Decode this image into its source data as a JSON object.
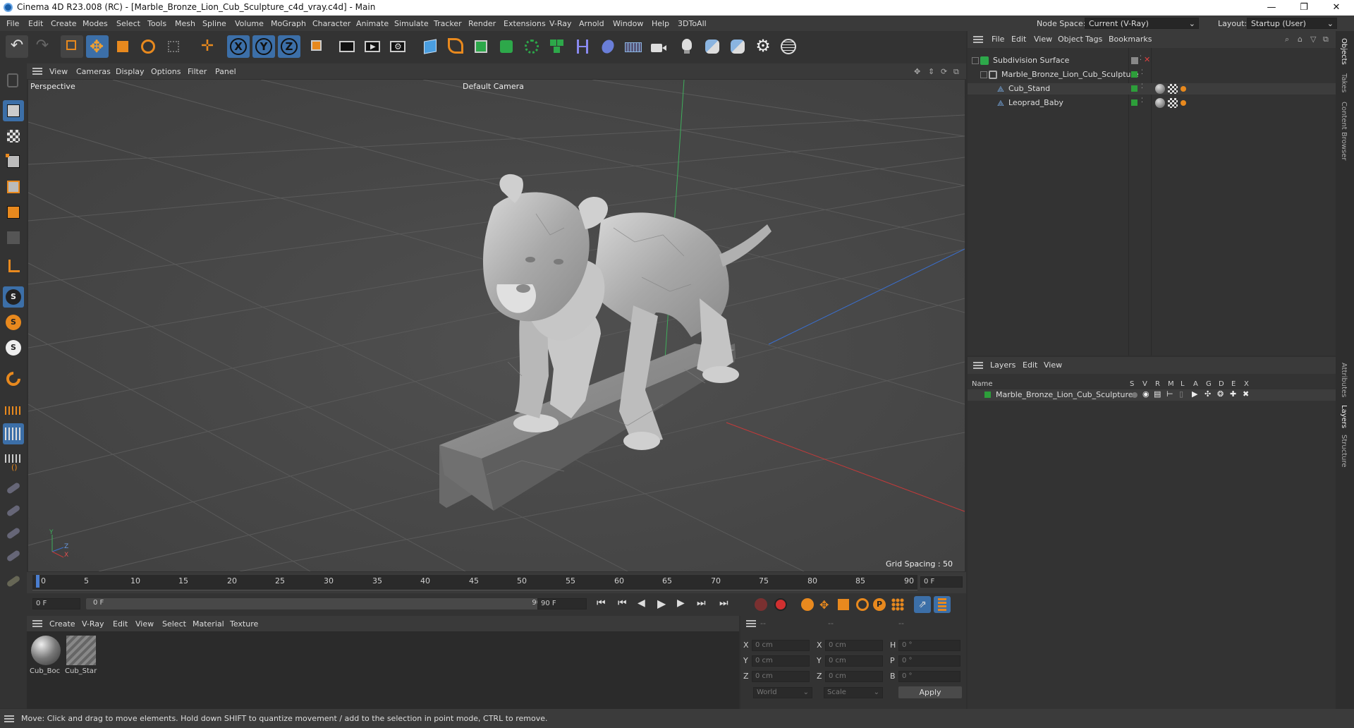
{
  "app": {
    "title": "Cinema 4D R23.008 (RC) - [Marble_Bronze_Lion_Cub_Sculpture_c4d_vray.c4d] - Main"
  },
  "menu": {
    "items": [
      "File",
      "Edit",
      "Create",
      "Modes",
      "Select",
      "Tools",
      "Mesh",
      "Spline",
      "Volume",
      "MoGraph",
      "Character",
      "Animate",
      "Simulate",
      "Tracker",
      "Render",
      "Extensions",
      "V-Ray",
      "Arnold",
      "Window",
      "Help",
      "3DToAll"
    ],
    "node_space_label": "Node Space:",
    "node_space_value": "Current (V-Ray)",
    "layout_label": "Layout:",
    "layout_value": "Startup (User)"
  },
  "viewport": {
    "menu": [
      "View",
      "Cameras",
      "Display",
      "Options",
      "Filter",
      "Panel"
    ],
    "name": "Perspective",
    "camera": "Default Camera",
    "grid_spacing": "Grid Spacing : 50 cm",
    "axis_y": "Y",
    "axis_z": "Z",
    "axis_x": "X"
  },
  "timeline": {
    "ticks": [
      "0",
      "5",
      "10",
      "15",
      "20",
      "25",
      "30",
      "35",
      "40",
      "45",
      "50",
      "55",
      "60",
      "65",
      "70",
      "75",
      "80",
      "85",
      "90"
    ],
    "frame_display": "0 F",
    "start_frame": "0 F",
    "range_start": "0 F",
    "range_end": "90 F",
    "end_frame": "90 F"
  },
  "materials": {
    "menu": [
      "Create",
      "V-Ray",
      "Edit",
      "View",
      "Select",
      "Material",
      "Texture"
    ],
    "items": [
      {
        "name": "Cub_Boc"
      },
      {
        "name": "Cub_Star"
      }
    ]
  },
  "coordinates": {
    "headers": [
      "--",
      "--",
      "--"
    ],
    "rows": [
      {
        "a": "X",
        "av": "0 cm",
        "b": "X",
        "bv": "0 cm",
        "c": "H",
        "cv": "0 °"
      },
      {
        "a": "Y",
        "av": "0 cm",
        "b": "Y",
        "bv": "0 cm",
        "c": "P",
        "cv": "0 °"
      },
      {
        "a": "Z",
        "av": "0 cm",
        "b": "Z",
        "bv": "0 cm",
        "c": "B",
        "cv": "0 °"
      }
    ],
    "space": "World",
    "mode": "Scale",
    "apply": "Apply"
  },
  "objects": {
    "menu": [
      "File",
      "Edit",
      "View",
      "Object",
      "Tags",
      "Bookmarks"
    ],
    "tree": [
      {
        "name": "Subdivision Surface",
        "indent": 0,
        "icon": "subdivision-icon"
      },
      {
        "name": "Marble_Bronze_Lion_Cub_Sculpture",
        "indent": 1,
        "icon": "null-icon"
      },
      {
        "name": "Cub_Stand",
        "indent": 2,
        "icon": "polygon-icon"
      },
      {
        "name": "Leoprad_Baby",
        "indent": 2,
        "icon": "polygon-icon"
      }
    ]
  },
  "layers": {
    "menu": [
      "Layers",
      "Edit",
      "View"
    ],
    "name_header": "Name",
    "col_headers": [
      "S",
      "V",
      "R",
      "M",
      "L",
      "A",
      "G",
      "D",
      "E",
      "X"
    ],
    "items": [
      {
        "name": "Marble_Bronze_Lion_Cub_Sculpture",
        "color": "#2d9e3a"
      }
    ]
  },
  "side_tabs": [
    "Objects",
    "Takes",
    "Content Browser",
    "Attributes",
    "Layers",
    "Structure"
  ],
  "status": {
    "text": "Move: Click and drag to move elements. Hold down SHIFT to quantize movement / add to the selection in point mode, CTRL to remove."
  },
  "colors": {
    "accent_orange": "#e8891e",
    "active_blue": "#3c6fa8",
    "green_swatch": "#2d9e3a"
  }
}
